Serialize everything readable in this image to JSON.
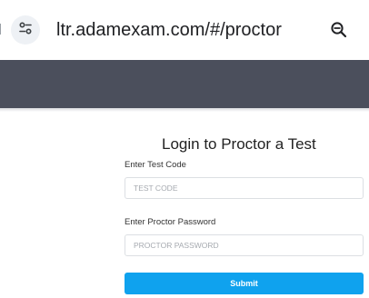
{
  "browser": {
    "url": "ltr.adamexam.com/#/proctor",
    "site_info_icon": "tune-icon",
    "zoom_icon": "zoom-out-icon"
  },
  "header": {
    "color": "#4b4f5c"
  },
  "form": {
    "title": "Login to Proctor a Test",
    "test_code_label": "Enter Test Code",
    "test_code_placeholder": "TEST CODE",
    "test_code_value": "",
    "password_label": "Enter Proctor Password",
    "password_placeholder": "PROCTOR PASSWORD",
    "password_value": "",
    "submit_label": "Submit",
    "accent_color": "#0fa2ee"
  }
}
